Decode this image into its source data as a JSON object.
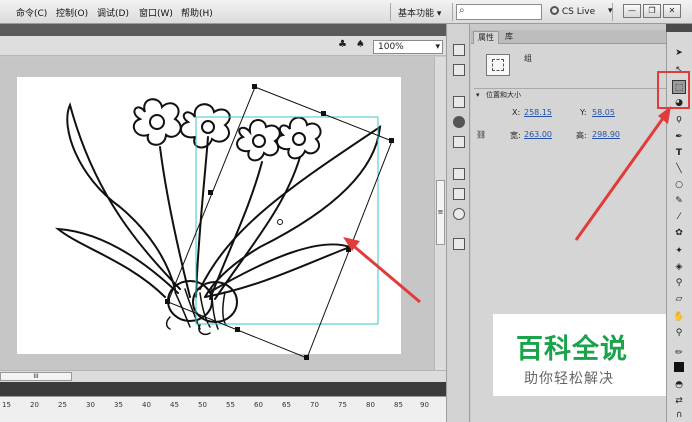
{
  "menu": {
    "items": [
      "命令(C)",
      "控制(O)",
      "调试(D)",
      "窗口(W)",
      "帮助(H)"
    ],
    "workspace_label": "基本功能",
    "workspace_arrow": "▾",
    "search_icon": "⌕",
    "cs_live_label": "CS Live",
    "cs_live_arrow": "▾",
    "win_minimize": "—",
    "win_restore": "❐",
    "win_close": "✕"
  },
  "stage": {
    "zoom_value": "100%",
    "zoom_arrow": "▾",
    "hscroll_grip": "III",
    "vscroll_grip": "≡",
    "ruler_ticks": [
      "15",
      "20",
      "25",
      "30",
      "35",
      "40",
      "45",
      "50",
      "55",
      "60",
      "65",
      "70",
      "75",
      "80",
      "85",
      "90"
    ]
  },
  "properties": {
    "tab_properties": "属性",
    "tab_library": "库",
    "object_type": "组",
    "section_position_size": "位置和大小",
    "x_label": "X:",
    "x_value": "258.15",
    "y_label": "Y:",
    "y_value": "58.05",
    "width_label": "宽:",
    "width_value": "263.00",
    "height_label": "高:",
    "height_value": "298.90"
  },
  "watermark": {
    "title": "百科全说",
    "subtitle": "助你轻松解决"
  },
  "colors": {
    "annotation_red": "#e23b3b",
    "watermark_green": "#1aa34a",
    "link_blue": "#2352a8"
  }
}
